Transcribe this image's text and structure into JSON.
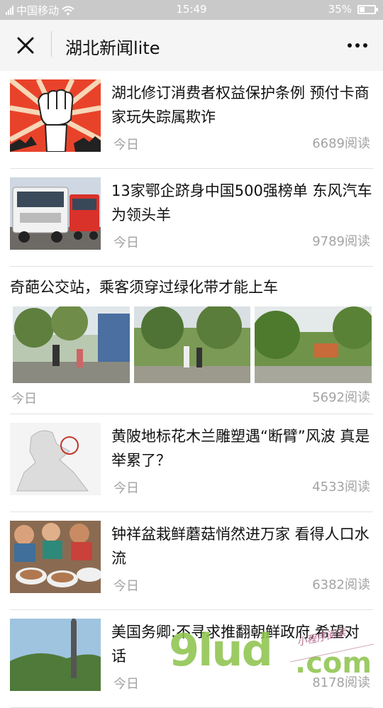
{
  "status_bar": {
    "carrier": "中国移动",
    "time": "15:49",
    "battery": "35%",
    "battery_level": 0.35
  },
  "header": {
    "title": "湖北新闻lite"
  },
  "articles": [
    {
      "title": "湖北修订消费者权益保护条例 预付卡商家玩失踪属欺诈",
      "date": "今日",
      "reads": "6689阅读"
    },
    {
      "title": "13家鄂企跻身中国500强榜单 东风汽车为领头羊",
      "date": "今日",
      "reads": "9789阅读"
    },
    {
      "title": "奇葩公交站，乘客须穿过绿化带才能上车",
      "date": "今日",
      "reads": "5692阅读"
    },
    {
      "title": "黄陂地标花木兰雕塑遇“断臂”风波 真是举累了？",
      "date": "今日",
      "reads": "4533阅读"
    },
    {
      "title": "钟祥盆栽鲜蘑菇悄然进万家 看得人口水流",
      "date": "今日",
      "reads": "6382阅读"
    },
    {
      "title": "美国务卿:不寻求推翻朝鲜政府,希望对话",
      "date": "今日",
      "reads": "8178阅读"
    }
  ],
  "watermark": {
    "main": "9lud",
    "domain": ".com",
    "sub": "小程序阅读"
  },
  "colors": {
    "accent_green": "#8bc34a",
    "gray_text": "#a3a3a3",
    "header_bg": "#f5f5f5"
  },
  "icons": [
    "signal-icon",
    "wifi-icon",
    "battery-icon",
    "close-icon",
    "more-icon"
  ]
}
